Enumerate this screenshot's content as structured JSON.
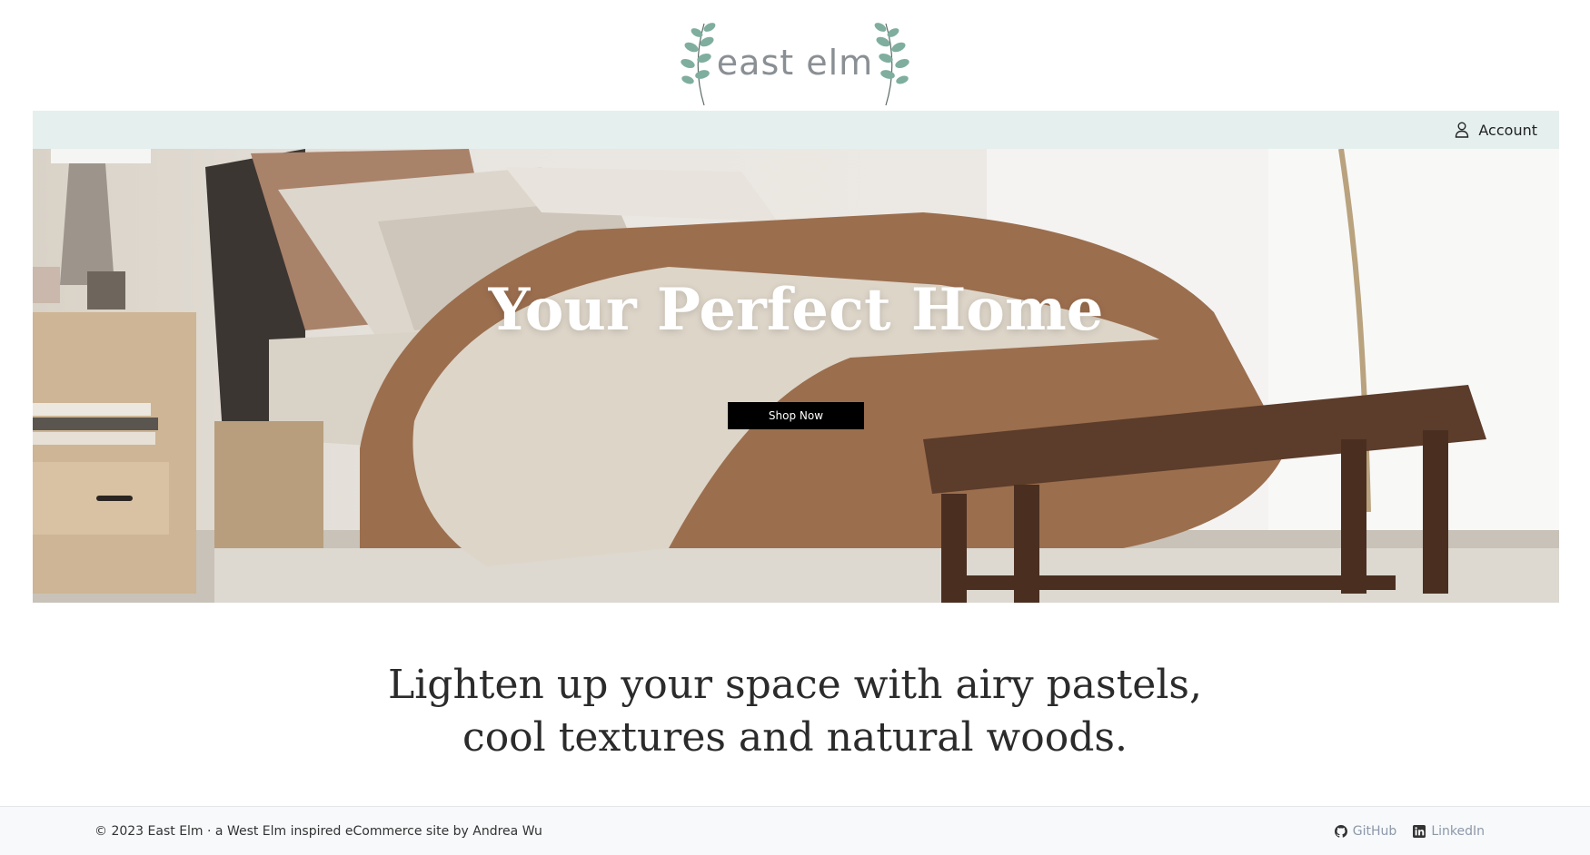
{
  "brand": {
    "name": "east elm",
    "accent": "#6f9a8d"
  },
  "nav": {
    "account_label": "Account",
    "account_icon": "user-icon",
    "bar_color": "#e5efee"
  },
  "hero": {
    "title": "Your Perfect Home",
    "cta_label": "Shop Now"
  },
  "tagline": {
    "line1": "Lighten up your space with airy pastels,",
    "line2": "cool textures and natural woods."
  },
  "footer": {
    "copyright": "© 2023 East Elm  ·  a West Elm inspired eCommerce site by Andrea Wu",
    "links": [
      {
        "label": "GitHub",
        "icon": "github-icon"
      },
      {
        "label": "LinkedIn",
        "icon": "linkedin-icon"
      }
    ],
    "link_color": "#8d98a8"
  }
}
